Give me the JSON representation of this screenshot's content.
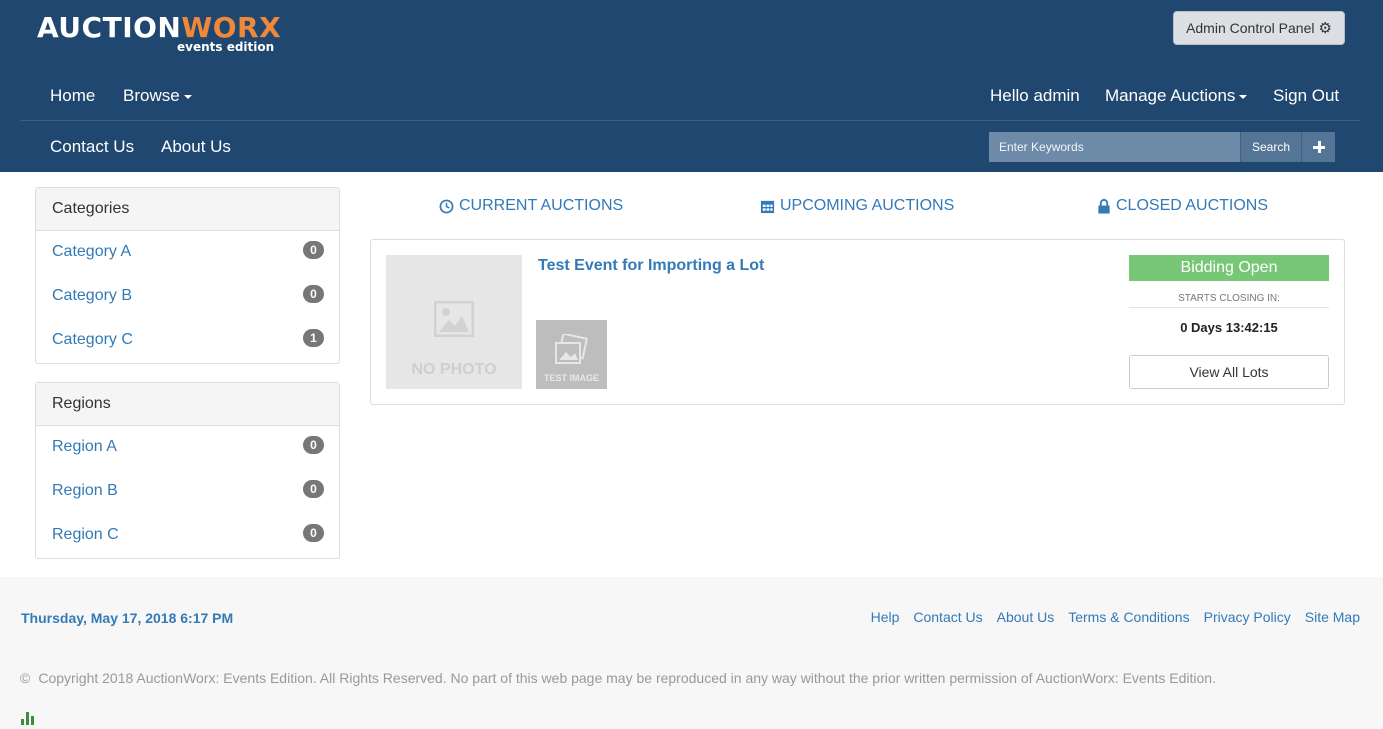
{
  "header": {
    "logo_main": "AUCTION",
    "logo_accent": "WORX",
    "logo_sub": "events edition",
    "admin_button": "Admin Control Panel"
  },
  "nav": {
    "home": "Home",
    "browse": "Browse",
    "hello": "Hello admin",
    "manage": "Manage Auctions",
    "signout": "Sign Out",
    "contact": "Contact Us",
    "about": "About Us"
  },
  "search": {
    "placeholder": "Enter Keywords",
    "button": "Search"
  },
  "categories": {
    "title": "Categories",
    "items": [
      {
        "label": "Category A",
        "count": "0"
      },
      {
        "label": "Category B",
        "count": "0"
      },
      {
        "label": "Category C",
        "count": "1"
      }
    ]
  },
  "regions": {
    "title": "Regions",
    "items": [
      {
        "label": "Region A",
        "count": "0"
      },
      {
        "label": "Region B",
        "count": "0"
      },
      {
        "label": "Region C",
        "count": "0"
      }
    ]
  },
  "tabs": {
    "current": "CURRENT AUCTIONS",
    "upcoming": "UPCOMING AUCTIONS",
    "closed": "CLOSED AUCTIONS"
  },
  "auction": {
    "title": "Test Event for Importing a Lot",
    "no_photo": "NO PHOTO",
    "thumb_label": "TEST IMAGE",
    "status": "Bidding Open",
    "closing_label": "STARTS CLOSING IN:",
    "countdown": "0 Days 13:42:15",
    "view_lots": "View All Lots"
  },
  "colors": {
    "header_bg": "#1f476f",
    "accent": "#f0883a",
    "link": "#337ab7",
    "status_green": "#77c777"
  },
  "footer": {
    "date": "Thursday, May 17, 2018 6:17 PM",
    "links": [
      "Help",
      "Contact Us",
      "About Us",
      "Terms & Conditions",
      "Privacy Policy",
      "Site Map"
    ],
    "copyright_symbol": "©",
    "copyright": "Copyright 2018 AuctionWorx: Events Edition. All Rights Reserved. No part of this web page may be reproduced in any way without the prior written permission of AuctionWorx: Events Edition."
  }
}
